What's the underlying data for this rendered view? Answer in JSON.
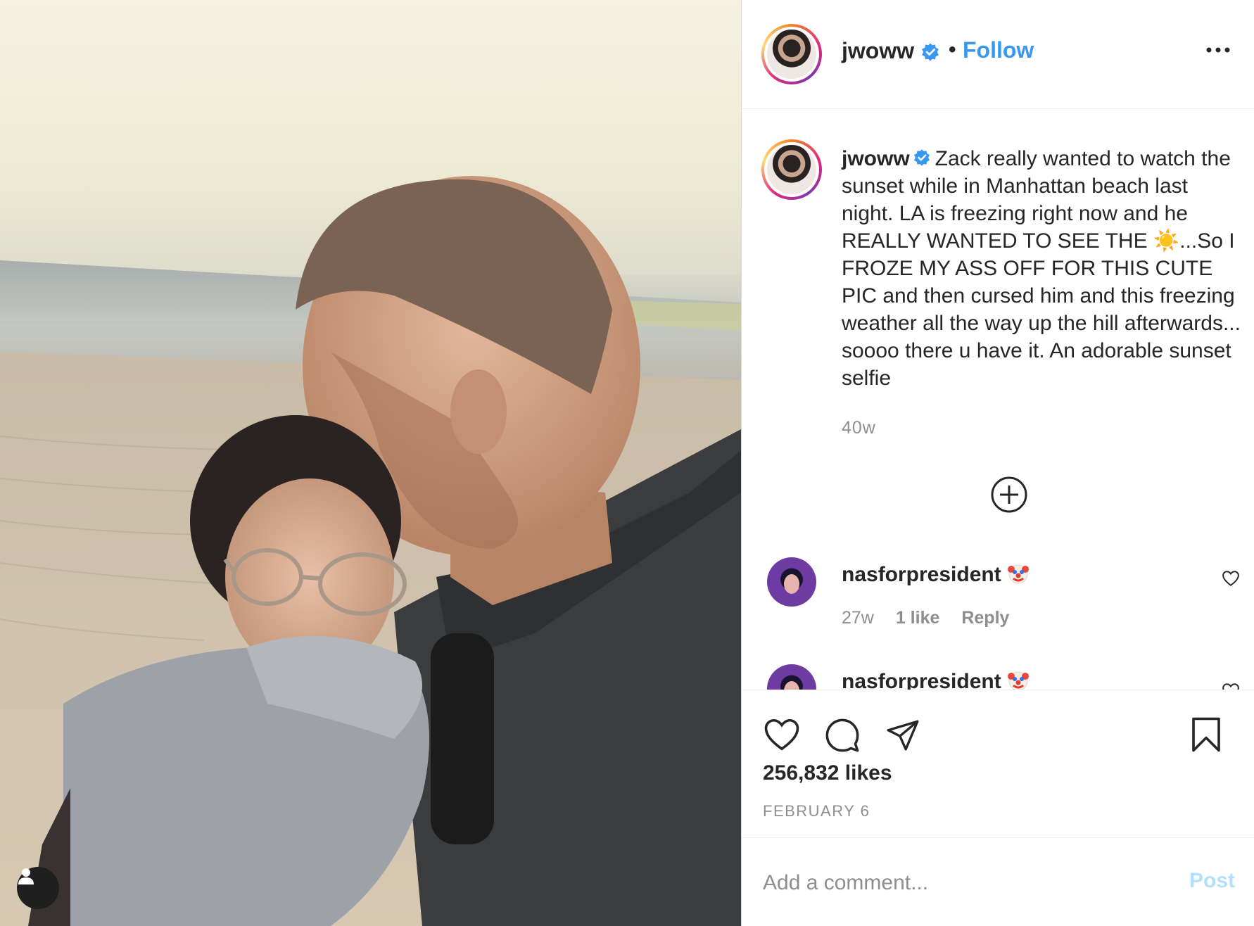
{
  "post": {
    "username": "jwoww",
    "follow_label": "Follow",
    "separator": "•",
    "caption": "Zack really wanted to watch the sunset while in Manhattan beach last night. LA is freezing right now and he REALLY WANTED TO SEE THE ☀️...So I FROZE MY ASS OFF FOR THIS CUTE PIC and then cursed him and this freezing weather all the way up the hill afterwards... soooo there u have it. An adorable sunset selfie",
    "caption_age": "40w",
    "likes": "256,832 likes",
    "date": "FEBRUARY 6"
  },
  "comments": [
    {
      "username": "nasforpresident",
      "emoji": "clown-face-icon",
      "age": "27w",
      "likes": "1 like",
      "reply": "Reply"
    },
    {
      "username": "nasforpresident",
      "emoji": "clown-face-icon"
    }
  ],
  "comment_box": {
    "placeholder": "Add a comment...",
    "post_label": "Post"
  },
  "colors": {
    "accent": "#3897f0",
    "post_disabled": "#b2dffc",
    "text": "#262626",
    "muted": "#8e8e8e",
    "border": "#efefef"
  },
  "icons": [
    "user-tag-icon",
    "verified-badge-icon",
    "more-options-icon",
    "add-circle-icon",
    "heart-icon",
    "comment-icon",
    "share-icon",
    "bookmark-icon"
  ]
}
